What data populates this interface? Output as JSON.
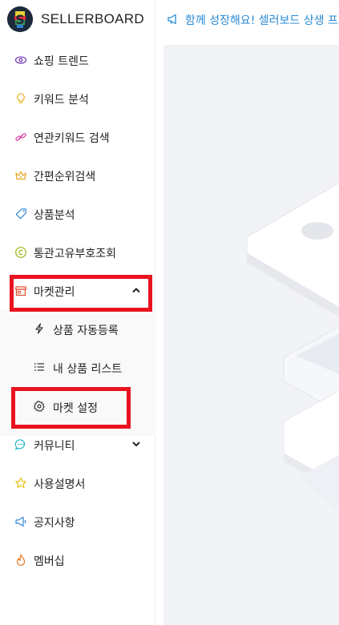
{
  "brand": {
    "name": "SELLERBOARD"
  },
  "sidebar": {
    "items": [
      {
        "label": "쇼핑 트렌드",
        "icon": "eye-icon"
      },
      {
        "label": "키워드 분석",
        "icon": "lightbulb-icon"
      },
      {
        "label": "연관키워드 검색",
        "icon": "link-icon"
      },
      {
        "label": "간편순위검색",
        "icon": "crown-icon"
      },
      {
        "label": "상품분석",
        "icon": "tag-icon"
      },
      {
        "label": "통관고유부호조회",
        "icon": "copyright-icon"
      },
      {
        "label": "마켓관리",
        "icon": "store-icon",
        "expanded": true
      },
      {
        "label": "커뮤니티",
        "icon": "chat-icon",
        "expanded": false
      },
      {
        "label": "사용설명서",
        "icon": "star-icon"
      },
      {
        "label": "공지사항",
        "icon": "megaphone-icon"
      },
      {
        "label": "멤버십",
        "icon": "fire-icon"
      }
    ],
    "market_submenu": [
      {
        "label": "상품 자동등록",
        "icon": "bolt-icon"
      },
      {
        "label": "내 상품 리스트",
        "icon": "list-icon"
      },
      {
        "label": "마켓 설정",
        "icon": "gear-icon"
      }
    ]
  },
  "header": {
    "notice": "함께 성장해요! 셀러보드 상생 프로젝트"
  },
  "colors": {
    "highlight": "#e8131f",
    "notice": "#2a8bd6",
    "main_bg": "#f2f3f6"
  }
}
